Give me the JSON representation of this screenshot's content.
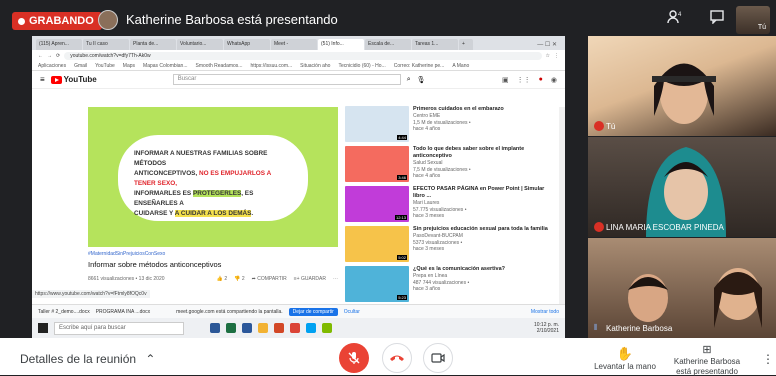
{
  "top": {
    "recording_label": "GRABANDO",
    "presenting_text": "Katherine Barbosa está presentando",
    "people_icon": "people-icon",
    "chat_icon": "chat-icon",
    "self_label": "Tú"
  },
  "browser": {
    "tabs": [
      "(115) Apren...",
      "Tu II caso",
      "Planta de...",
      "Voluntario...",
      "WhatsApp",
      "Meet -",
      "(51) Info...",
      "Escala de...",
      "Tareas 1...",
      "+"
    ],
    "address": "youtube.com/watch?v=dfy7Th-Ak0w",
    "bookmarks": [
      "Aplicaciones",
      "Gmail",
      "YouTube",
      "Maps",
      "Mapas Colombian...",
      "Smooth Readamos...",
      "https://issuu.com...",
      "Situación aho",
      "Tecnicidio (60) - Ho...",
      "Correo: Katherine pe...",
      "A Mano"
    ]
  },
  "youtube": {
    "logo_text": "YouTube",
    "search_placeholder": "Buscar",
    "video_text": {
      "l1": "INFORMAR A NUESTRAS FAMILIAS SOBRE MÉTODOS",
      "l2a": "ANTICONCEPTIVOS, ",
      "l2b": "NO ES EMPUJARLOS A TENER SEXO,",
      "l3a": "INFORMARLES ES ",
      "l3b": "PROTEGERLES",
      "l3c": ", ES ENSEÑARLES A",
      "l4a": "CUIDARSE Y ",
      "l4b": "A CUIDAR A LOS DEMÁS",
      "l4c": "."
    },
    "tags": "#MaternidadSinPrejuiciosConSexo",
    "title": "Informar sobre métodos anticonceptivos",
    "views": "8661 visualizaciones • 13 dic 2020",
    "likes": "2",
    "dislikes": "2",
    "share": "COMPARTIR",
    "save": "GUARDAR",
    "sidebar": [
      {
        "title": "Primeros cuidados en el embarazo",
        "channel": "Centro EME",
        "meta": "1,5 M de visualizaciones •",
        "age": "hace 4 años",
        "dur": "4:44",
        "color": "#d6e4f0"
      },
      {
        "title": "Todo lo que debes saber sobre el implante anticonceptivo",
        "channel": "Salud Sexual",
        "meta": "7,5 M de visualizaciones •",
        "age": "hace 4 años",
        "dur": "3:46",
        "color": "#f46b5f"
      },
      {
        "title": "EFECTO PASAR PÁGINA en Power Point | Simular libro ...",
        "channel": "Mari Laures",
        "meta": "57.775 visualizaciones •",
        "age": "hace 3 meses",
        "dur": "12:13",
        "color": "#c13cd9"
      },
      {
        "title": "Sin prejuicios educación sexual para toda la familia",
        "channel": "PasoDevant-BUCPAM",
        "meta": "5373 visualizaciones •",
        "age": "hace 3 meses",
        "dur": "5:02",
        "color": "#f6c34a"
      },
      {
        "title": "¿Qué es la comunicación asertiva?",
        "channel": "Prepa en Línea",
        "meta": "487 744 visualizaciones •",
        "age": "hace 3 años",
        "dur": "5:23",
        "color": "#4fb3d9"
      }
    ]
  },
  "meet_share_bar": {
    "text": "meet.google.com está compartiendo la pantalla.",
    "stop_label": "Dejar de compartir",
    "hide_label": "Ocultar",
    "show_all": "Mostrar todo",
    "downloads": [
      "Taller # 2_demo....docx",
      "PROGRAMA INA ...docx"
    ]
  },
  "status_url": "https://www.youtube.com/watch?v=fFtmly8fOQc0v",
  "taskbar": {
    "search_placeholder": "Escribe aquí para buscar",
    "time": "10:12 p. m.",
    "date": "2/10/2021"
  },
  "participants": [
    {
      "name": "Tú"
    },
    {
      "name": "LINA MARIA ESCOBAR PINEDA"
    },
    {
      "name": "Katherine Barbosa"
    }
  ],
  "bottom": {
    "meeting_details": "Detalles de la reunión",
    "raise_hand": "Levantar la mano",
    "presenting_line1": "Katherine Barbosa",
    "presenting_line2": "está presentando"
  }
}
